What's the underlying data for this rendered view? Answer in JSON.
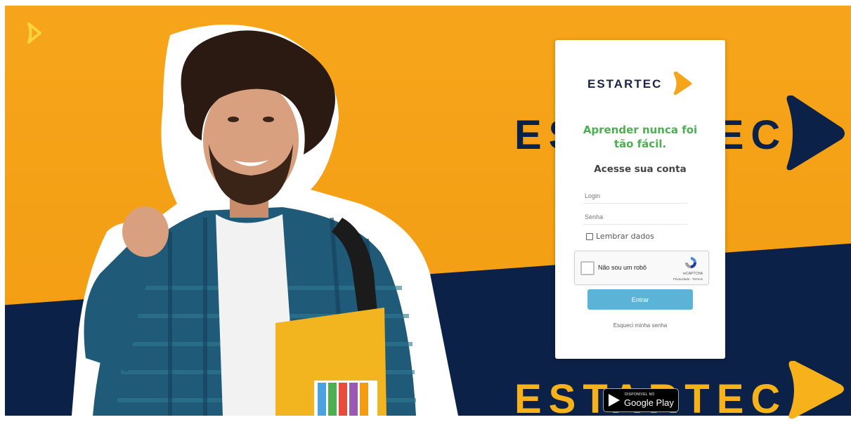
{
  "brand": {
    "name": "ESTARTEC",
    "colors": {
      "orange": "#f6a51a",
      "navy": "#0c2148",
      "green": "#4caf50",
      "button": "#5bb3d8"
    }
  },
  "background": {
    "wordmark_top": "ESTARTEC",
    "wordmark_bottom": "ESTARTEC"
  },
  "login": {
    "logo_text": "ESTARTEC",
    "tagline_line1": "Aprender nunca foi",
    "tagline_line2": "tão fácil.",
    "subtitle": "Acesse sua conta",
    "login_placeholder": "Login",
    "password_placeholder": "Senha",
    "remember_label": "Lembrar dados",
    "captcha": {
      "label": "Não sou um robô",
      "brand": "reCAPTCHA",
      "links": "Privacidade - Termos"
    },
    "submit_label": "Entrar",
    "forgot_label": "Esqueci minha senha"
  },
  "store_badge": {
    "small_text": "DISPONÍVEL NO",
    "big_text": "Google Play"
  }
}
